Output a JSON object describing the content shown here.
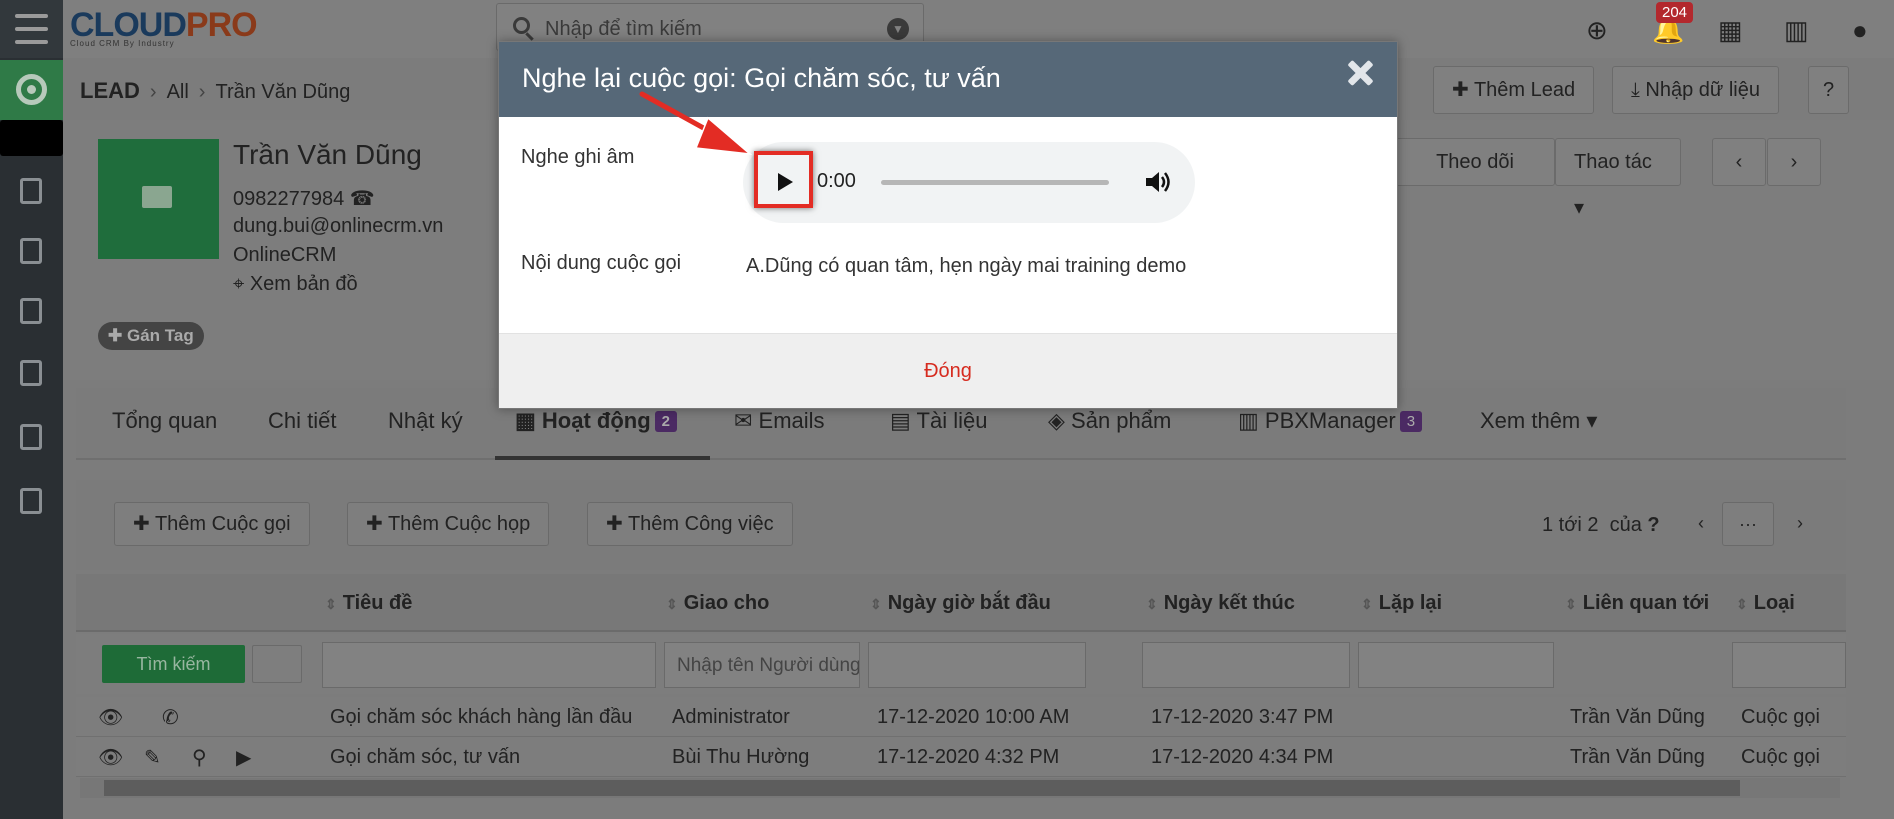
{
  "app": {
    "logo_main": "CLOUD",
    "logo_accent": "PRO",
    "logo_tagline": "Cloud CRM By Industry"
  },
  "topbar": {
    "search_placeholder": "Nhập để tìm kiếm",
    "notifications_count": "204",
    "icons": [
      "plus-circle-icon",
      "bell-icon",
      "calendar-icon",
      "chart-icon",
      "user-icon"
    ]
  },
  "breadcrumb": {
    "module": "LEAD",
    "level1": "All",
    "level2": "Trần Văn Dũng"
  },
  "header_buttons": {
    "add_lead": "Thêm Lead",
    "import": "Nhập dữ liệu",
    "help": "?"
  },
  "record": {
    "name": "Trần Văn Dũng",
    "phone": "0982277984",
    "email": "dung.bui@onlinecrm.vn",
    "company": "OnlineCRM",
    "map_link": "Xem bản đồ",
    "tag_button": "Gán Tag",
    "follow": "Theo dõi",
    "actions": "Thao tác"
  },
  "tabs": [
    {
      "label": "Tổng quan"
    },
    {
      "label": "Chi tiết"
    },
    {
      "label": "Nhật ký"
    },
    {
      "label": "Hoạt động",
      "count": "2"
    },
    {
      "label": "Emails"
    },
    {
      "label": "Tài liệu"
    },
    {
      "label": "Sản phẩm"
    },
    {
      "label": "PBXManager",
      "count": "3"
    },
    {
      "label": "Xem thêm"
    }
  ],
  "activity_toolbar": {
    "add_call": "Thêm Cuộc gọi",
    "add_meeting": "Thêm Cuộc họp",
    "add_task": "Thêm Công việc",
    "pager_text": "1 tới 2",
    "pager_of": "của",
    "pager_total": "?",
    "pager_more": "···"
  },
  "table": {
    "columns": [
      "Tiêu đề",
      "Giao cho",
      "Ngày giờ bắt đầu",
      "Ngày kết thúc",
      "Lặp lại",
      "Liên quan tới",
      "Loại"
    ],
    "search_button": "Tìm kiếm",
    "assignee_placeholder": "Nhập tên Người dùng",
    "rows": [
      {
        "title": "Gọi chăm sóc khách hàng lần đầu",
        "assignee": "Administrator",
        "start": "17-12-2020 10:00 AM",
        "end": "17-12-2020 3:47 PM",
        "repeat": "",
        "related": "Trần Văn Dũng",
        "type": "Cuộc gọi"
      },
      {
        "title": "Gọi chăm sóc, tư vấn",
        "assignee": "Bùi Thu Hường",
        "start": "17-12-2020 4:32 PM",
        "end": "17-12-2020 4:34 PM",
        "repeat": "",
        "related": "Trần Văn Dũng",
        "type": "Cuộc gọi"
      }
    ]
  },
  "modal": {
    "title": "Nghe lại cuộc gọi: Gọi chăm sóc, tư vấn",
    "recording_label": "Nghe ghi âm",
    "audio_time": "0:00",
    "audio_progress": 0,
    "content_label": "Nội dung cuộc gọi",
    "content_value": "A.Dũng có quan tâm, hẹn ngày mai training demo",
    "close_button": "Đóng"
  },
  "colors": {
    "modal_header": "#566878",
    "close_text": "#d62b1f",
    "highlight_box": "#e32c24",
    "annotation_arrow": "#e32c24"
  }
}
